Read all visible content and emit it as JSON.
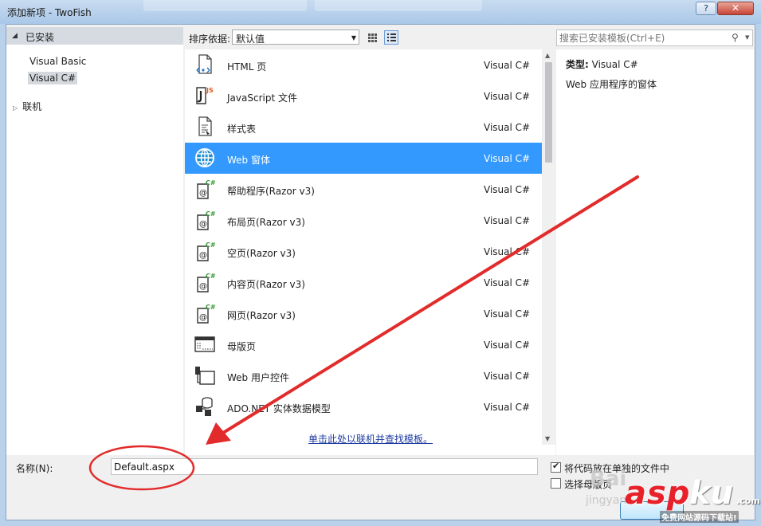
{
  "window": {
    "title": "添加新项 - TwoFish",
    "help_label": "?",
    "close_label": "✕"
  },
  "categories": {
    "header": "已安装",
    "items": [
      {
        "label": "Visual Basic",
        "selected": false
      },
      {
        "label": "Visual C#",
        "selected": true
      }
    ],
    "online": "联机"
  },
  "sort": {
    "label": "排序依据:",
    "value": "默认值"
  },
  "search": {
    "placeholder": "搜索已安装模板(Ctrl+E)"
  },
  "templates": [
    {
      "name": "HTML 页",
      "lang": "Visual C#",
      "icon": "html-page-icon",
      "selected": false
    },
    {
      "name": "JavaScript 文件",
      "lang": "Visual C#",
      "icon": "javascript-file-icon",
      "selected": false
    },
    {
      "name": "样式表",
      "lang": "Visual C#",
      "icon": "stylesheet-icon",
      "selected": false
    },
    {
      "name": "Web 窗体",
      "lang": "Visual C#",
      "icon": "web-form-globe-icon",
      "selected": true
    },
    {
      "name": "帮助程序(Razor v3)",
      "lang": "Visual C#",
      "icon": "razor-helper-icon",
      "selected": false
    },
    {
      "name": "布局页(Razor v3)",
      "lang": "Visual C#",
      "icon": "razor-layout-icon",
      "selected": false
    },
    {
      "name": "空页(Razor v3)",
      "lang": "Visual C#",
      "icon": "razor-empty-icon",
      "selected": false
    },
    {
      "name": "内容页(Razor v3)",
      "lang": "Visual C#",
      "icon": "razor-content-icon",
      "selected": false
    },
    {
      "name": "网页(Razor v3)",
      "lang": "Visual C#",
      "icon": "razor-webpage-icon",
      "selected": false
    },
    {
      "name": "母版页",
      "lang": "Visual C#",
      "icon": "master-page-icon",
      "selected": false
    },
    {
      "name": "Web 用户控件",
      "lang": "Visual C#",
      "icon": "user-control-icon",
      "selected": false
    },
    {
      "name": "ADO.NET 实体数据模型",
      "lang": "Visual C#",
      "icon": "entity-model-icon",
      "selected": false
    }
  ],
  "online_link": "单击此处以联机并查找模板。",
  "details": {
    "type_label": "类型:",
    "type_value": "Visual C#",
    "description": "Web 应用程序的窗体"
  },
  "name_field": {
    "label": "名称(N):",
    "value": "Default.aspx"
  },
  "options": [
    {
      "label": "将代码放在单独的文件中",
      "checked": true
    },
    {
      "label": "选择母版页",
      "checked": false
    }
  ],
  "watermarks": {
    "asp": "asp",
    "ku": "ku",
    "com": ".com",
    "sub": "免费网站源码下载站!",
    "jingyan": "jingyan",
    "baidu": "Bai"
  },
  "colors": {
    "selection": "#3399ff",
    "annotation_red": "#e22b2b"
  }
}
